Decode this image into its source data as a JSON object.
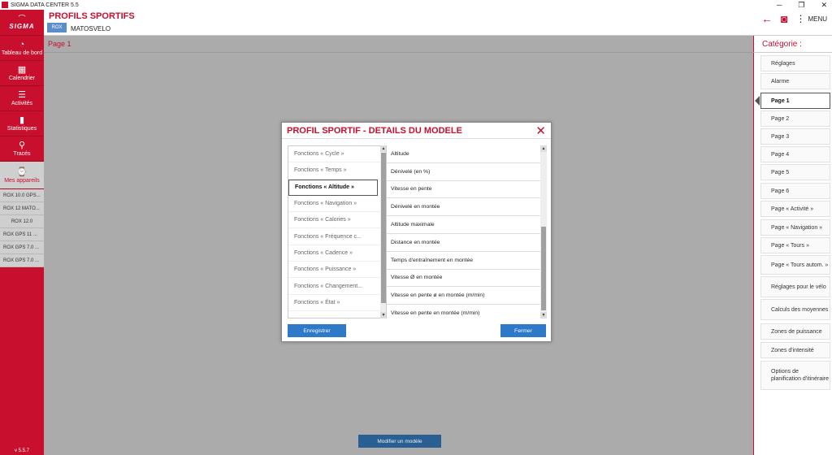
{
  "window": {
    "title": "SIGMA DATA CENTER 5.5",
    "minimize": "─",
    "restore": "❐",
    "close": "✕"
  },
  "sidebar": {
    "logo": "SIGMA",
    "nav": [
      {
        "label": "Tableau de bord",
        "icon": "◔"
      },
      {
        "label": "Calendrier",
        "icon": "▦"
      },
      {
        "label": "Activités",
        "icon": "☰"
      },
      {
        "label": "Statistiques",
        "icon": "▮"
      },
      {
        "label": "Tracés",
        "icon": "⚲"
      }
    ],
    "devices_label": "Mes appareils",
    "devices_icon": "⌚",
    "devices": [
      "ROX 10.0 GPS...",
      "ROX 12 MATO...",
      "ROX 12.0",
      "ROX GPS 11 ...",
      "ROX GPS 7.0 ...",
      "ROX GPS 7.0 ..."
    ],
    "version": "v 5.5.7"
  },
  "header": {
    "title": "PROFILS SPORTIFS",
    "device_name": "MATOSVELO",
    "device_icon_text": "ROX",
    "back_icon": "←",
    "camera_icon": "◙",
    "menu_icon": "⋮",
    "menu_label": "MENU"
  },
  "main": {
    "page_label": "Page 1",
    "modify_button": "Modifier un modèle"
  },
  "categories": {
    "title": "Catégorie :",
    "items": [
      "Réglages",
      "Alarme",
      "Page 1",
      "Page 2",
      "Page 3",
      "Page 4",
      "Page 5",
      "Page 6",
      "Page « Activité »",
      "Page « Navigation »",
      "Page « Tours »",
      "Page « Tours autom. »",
      "Réglages pour le vélo",
      "Calculs des moyennes",
      "Zones de puissance",
      "Zones d'intensité",
      "Options de planification d'itinéraire"
    ],
    "active": "Page 1"
  },
  "modal": {
    "title": "PROFIL SPORTIF - DETAILS DU MODELE",
    "close": "✕",
    "functions": [
      "Fonctions « Cycle »",
      "Fonctions « Temps »",
      "Fonctions « Altitude »",
      "Fonctions « Navigation »",
      "Fonctions « Calories »",
      "Fonctions « Fréquence c...",
      "Fonctions « Cadence »",
      "Fonctions « Puissance »",
      "Fonctions « Changement...",
      "Fonctions « État »"
    ],
    "active_function": "Fonctions « Altitude »",
    "values": [
      "Altitude",
      "Dénivelé (en %)",
      "Vitesse en pente",
      "Dénivelé en montée",
      "Altitude maximale",
      "Distance en montée",
      "Temps d'entraînement en montée",
      "Vitesse Ø en montée",
      "Vitesse en pente ø en montée (m/min)",
      "Vitesse en pente en montée (m/min)"
    ],
    "save_button": "Enregistrer",
    "close_button": "Fermer",
    "scroll_up": "▲",
    "scroll_down": "▼"
  }
}
